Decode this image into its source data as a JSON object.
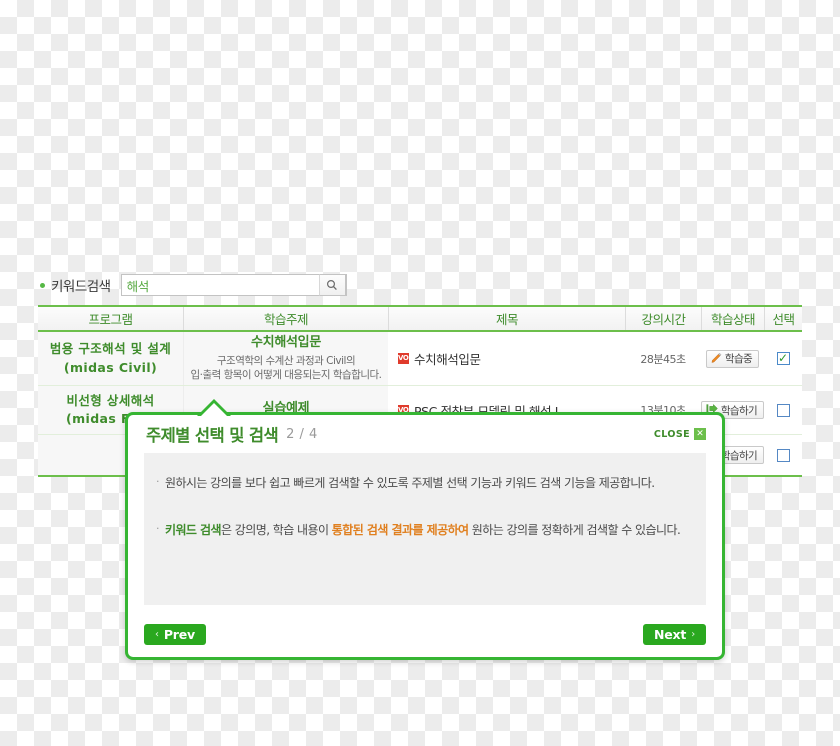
{
  "search": {
    "bullet_label": "키워드검색",
    "value": "해석",
    "placeholder": "",
    "search_icon": "magnifier-icon"
  },
  "table": {
    "columns": [
      {
        "key": "program",
        "label": "프로그램"
      },
      {
        "key": "topic",
        "label": "학습주제"
      },
      {
        "key": "title",
        "label": "제목"
      },
      {
        "key": "time",
        "label": "강의시간"
      },
      {
        "key": "state",
        "label": "학습상태"
      },
      {
        "key": "select",
        "label": "선택"
      }
    ],
    "rows": [
      {
        "program": "범용 구조해석 및 설계",
        "program_sub": "(midas Civil)",
        "topic": "수치해석입문",
        "topic_desc_line1": "구조역학의 수계산 과정과 Civil의",
        "topic_desc_line2": "입·출력 항목이 어떻게 대응되는지 학습합니다.",
        "badge": "VOD",
        "title": "수치해석입문",
        "time": "28분45초",
        "state_label": "학습중",
        "state_icon": "pencil-icon",
        "checked": true
      },
      {
        "program": "비선형 상세해석",
        "program_sub": "(midas FEA)",
        "topic": "실습예제",
        "topic_desc_line1": "",
        "topic_desc_line2": "",
        "badge": "VOD",
        "title": "PSC 정착부 모델링 및 해석 Ⅰ",
        "time": "13분10초",
        "state_label": "학습하기",
        "state_icon": "enter-arrow-icon",
        "checked": false
      },
      {
        "program": "",
        "program_sub": "",
        "topic": "",
        "topic_desc_line1": "",
        "topic_desc_line2": "",
        "badge": "",
        "title": "",
        "time": "",
        "state_label": "학습하기",
        "state_icon": "enter-arrow-icon",
        "checked": false
      }
    ]
  },
  "guide": {
    "title": "주제별 선택 및 검색",
    "page": "2 / 4",
    "close_label": "CLOSE",
    "close_icon": "close-x-icon",
    "bullets": [
      {
        "segments": [
          {
            "text": "원하시는 강의를 보다 쉽고 빠르게 검색할 수 있도록 주제별 선택 기능과 키워드 검색 기능을 제공합니다.",
            "style": "plain"
          }
        ]
      },
      {
        "segments": [
          {
            "text": "키워드 검색",
            "style": "green"
          },
          {
            "text": "은 강의명, 학습 내용이 ",
            "style": "plain"
          },
          {
            "text": "통합된 검색 결과를 제공하여",
            "style": "orange"
          },
          {
            "text": " 원하는 강의를 정확하게 검색할 수 있습니다.",
            "style": "plain"
          }
        ]
      }
    ],
    "prev_label": "Prev",
    "next_label": "Next",
    "prev_chevron": "‹",
    "next_chevron": "›"
  },
  "colors": {
    "brand_green": "#3f8c2c",
    "border_green": "#6cbf4b",
    "popup_green": "#36b533",
    "button_green": "#2aa81f",
    "accent_orange": "#e08020",
    "badge_red": "#e03b2c"
  }
}
